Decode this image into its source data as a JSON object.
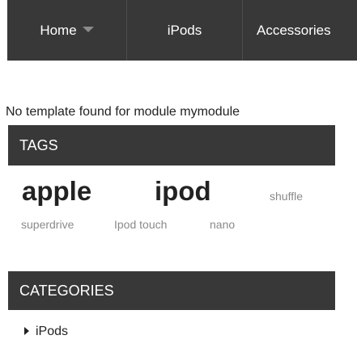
{
  "nav": {
    "items": [
      {
        "label": "Home",
        "has_dropdown": true
      },
      {
        "label": "iPods",
        "has_dropdown": false
      },
      {
        "label": "Accessories",
        "has_dropdown": false
      }
    ]
  },
  "module_notice": "No template found for module mymodule",
  "tags_section": {
    "title": "TAGS",
    "tags": [
      {
        "label": "apple",
        "weight": "large"
      },
      {
        "label": "ipod",
        "weight": "large"
      },
      {
        "label": "shuffle",
        "weight": "small"
      },
      {
        "label": "superdrive",
        "weight": "small"
      },
      {
        "label": "Ipod touch",
        "weight": "small"
      },
      {
        "label": "nano",
        "weight": "small"
      }
    ]
  },
  "categories_section": {
    "title": "CATEGORIES",
    "items": [
      {
        "label": "iPods"
      }
    ]
  },
  "colors": {
    "bar_background": "#383838",
    "bar_text": "#ffffff",
    "tag_small": "#8a8a8a",
    "text_dark": "#222222"
  },
  "icons": [
    "chevron-down-icon",
    "triangle-right-icon"
  ]
}
